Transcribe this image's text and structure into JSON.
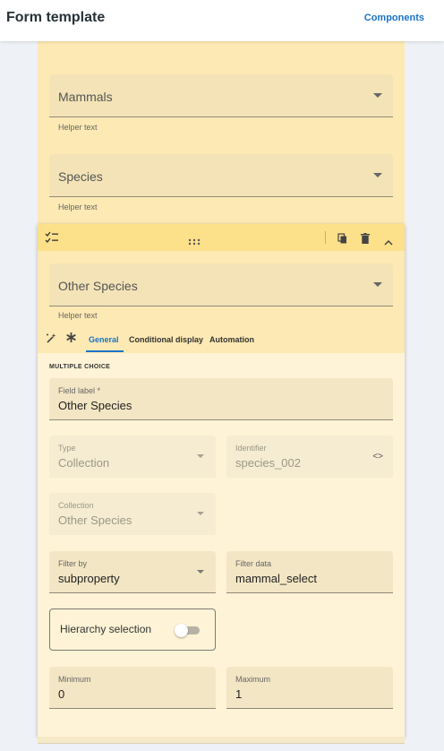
{
  "header": {
    "title": "Form template",
    "components_link": "Components"
  },
  "previous_fields": [
    {
      "value": "Mammals",
      "helper": "Helper text"
    },
    {
      "value": "Species",
      "helper": "Helper text"
    }
  ],
  "active_field": {
    "preview": {
      "value": "Other Species",
      "helper": "Helper text"
    },
    "tabs": [
      "General",
      "Conditional display",
      "Automation"
    ],
    "active_tab": "General",
    "section_label": "MULTIPLE CHOICE",
    "field_label": {
      "label": "Field label *",
      "value": "Other Species"
    },
    "type": {
      "label": "Type",
      "value": "Collection"
    },
    "identifier": {
      "label": "Identifier",
      "value": "species_002"
    },
    "collection": {
      "label": "Collection",
      "value": "Other Species"
    },
    "filter_by": {
      "label": "Filter by",
      "value": "subproperty"
    },
    "filter_data": {
      "label": "Filter data",
      "value": "mammal_select"
    },
    "hierarchy": {
      "label": "Hierarchy selection",
      "enabled": false
    },
    "minimum": {
      "label": "Minimum",
      "value": "0"
    },
    "maximum": {
      "label": "Maximum",
      "value": "1"
    }
  },
  "colors": {
    "accent": "#1a73c7",
    "card_header": "#fde08a",
    "card_body": "#fef3d6",
    "preview_bg": "#fde9b3"
  },
  "icons": [
    "checklist-icon",
    "drag-handle-icon",
    "copy-icon",
    "delete-icon",
    "chevron-up-icon",
    "magic-wand-icon",
    "asterisk-icon",
    "code-icon",
    "dropdown-arrow-icon"
  ]
}
